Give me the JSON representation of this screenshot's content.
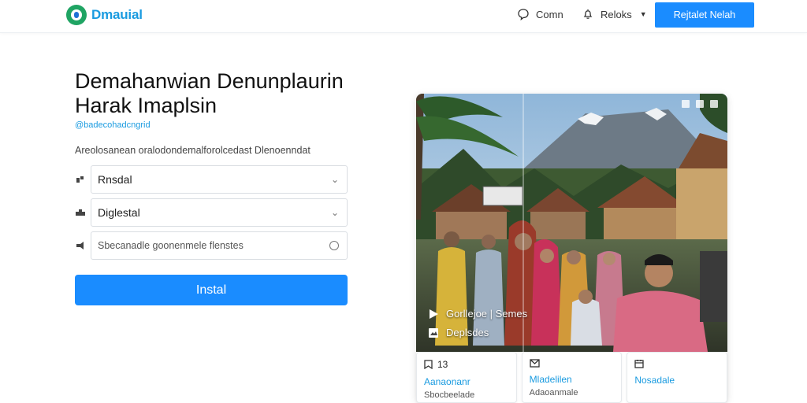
{
  "brand": {
    "name": "Dmauial"
  },
  "nav": {
    "contact": "Comn",
    "product": "Reloks",
    "cta": "Rejtalet Nelah"
  },
  "hero": {
    "headline_line1": "Demahanwian Denunplaurin",
    "headline_line2": "Harak Imaplsin",
    "subtag": "@badecohadcngrid",
    "description": "Areolosanean oralodondemalforolcedast Dlenoenndat"
  },
  "form": {
    "field1": "Rnsdal",
    "field2": "Diglestal",
    "field3_placeholder": "Sbecanadle goonenmele flenstes",
    "submit": "Instal"
  },
  "photo_card": {
    "overlay_title": "Gorllejoe | Semes",
    "overlay_sub": "Deplsdes"
  },
  "stats": [
    {
      "icon": "bookmark-icon",
      "number": "13",
      "label": "Aanaonanr",
      "sub": "Sbocbeelade"
    },
    {
      "icon": "mail-icon",
      "number": "",
      "label": "Mladelilen",
      "sub": "Adaoanmale"
    },
    {
      "icon": "calendar-icon",
      "number": "",
      "label": "Nosadale",
      "sub": ""
    }
  ],
  "colors": {
    "accent": "#1a8cff",
    "brand_text": "#1a9be0",
    "logo_green": "#1fa463"
  }
}
